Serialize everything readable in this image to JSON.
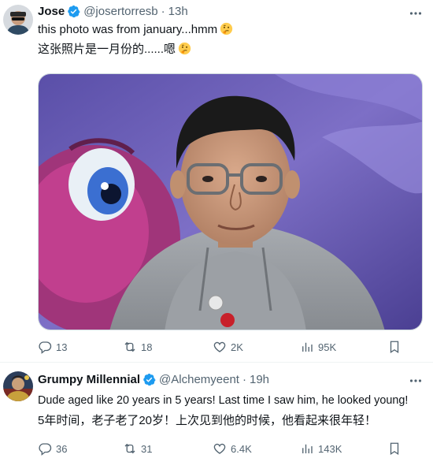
{
  "tweets": [
    {
      "author": {
        "name": "Jose",
        "handle": "@josertorresb",
        "time": "13h"
      },
      "lines": [
        "this photo was from january...hmm",
        "这张照片是一月份的......嗯"
      ],
      "emoji": "thinking-face",
      "has_photo": true,
      "stats": {
        "replies": "13",
        "retweets": "18",
        "likes": "2K",
        "views": "95K"
      }
    },
    {
      "author": {
        "name": "Grumpy Millennial",
        "handle": "@Alchemyeent",
        "time": "19h"
      },
      "lines": [
        "Dude aged like 20 years in 5 years! Last time I saw him, he looked young!",
        "5年时间，老子老了20岁！上次见到他的时候，他看起来很年轻！"
      ],
      "has_photo": false,
      "stats": {
        "replies": "36",
        "retweets": "31",
        "likes": "6.4K",
        "views": "143K"
      }
    }
  ],
  "colors": {
    "text": "#0f1419",
    "muted": "#536471",
    "verified": "#1d9bf0",
    "divider": "#eff3f4"
  },
  "icons": [
    "reply-icon",
    "retweet-icon",
    "like-icon",
    "views-icon",
    "bookmark-icon",
    "more-icon",
    "verified-badge-icon"
  ],
  "separator": "·"
}
